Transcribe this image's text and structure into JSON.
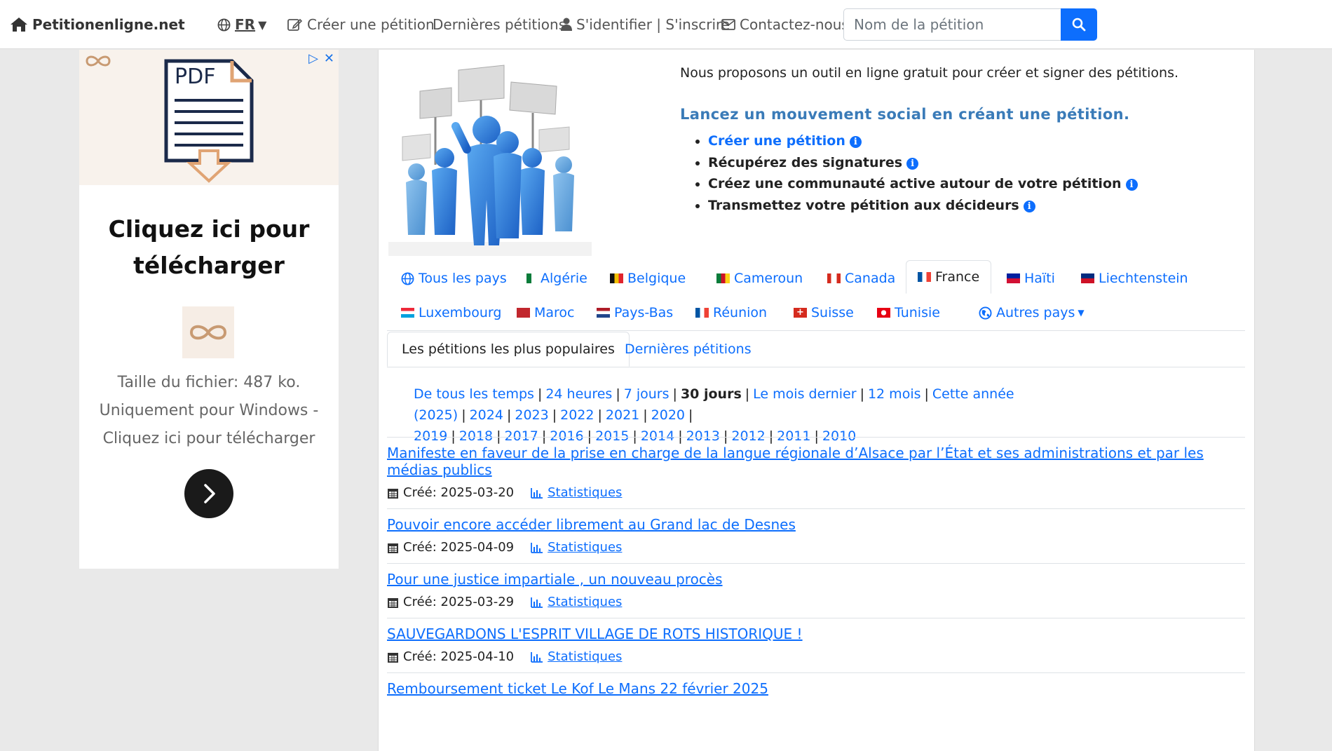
{
  "nav": {
    "brand": "Petitionenligne.net",
    "lang": "FR",
    "create": "Créer une pétition",
    "latest": "Dernières pétitions",
    "login": "S'identifier | S'inscrire",
    "contact": "Contactez-nous",
    "search_placeholder": "Nom de la pétition"
  },
  "ad": {
    "headline_line1": "Cliquez ici pour",
    "headline_line2": "télécharger",
    "pdf_label": "PDF",
    "desc_line1": "Taille du fichier: 487 ko.",
    "desc_line2": "Uniquement pour Windows -",
    "desc_line3": "Cliquez ici pour télécharger"
  },
  "intro": {
    "text": "Nous proposons un outil en ligne gratuit pour créer et signer des pétitions.",
    "slogan": "Lancez un mouvement social en créant une pétition.",
    "bullets": [
      "Créer une pétition",
      "Récupérez des signatures",
      "Créez une communauté active autour de votre pétition",
      "Transmettez votre pétition aux décideurs"
    ]
  },
  "countries": [
    {
      "label": "Tous les pays"
    },
    {
      "label": "Algérie",
      "flag": "#0a7c3a"
    },
    {
      "label": "Belgique",
      "flag": "#f2c000"
    },
    {
      "label": "Cameroun",
      "flag": "#0a7c3a"
    },
    {
      "label": "Canada",
      "flag": "#d52b1e"
    },
    {
      "label": "France",
      "flag": "#0055a4"
    },
    {
      "label": "Haïti",
      "flag": "#00209f"
    },
    {
      "label": "Liechtenstein",
      "flag": "#002b7f"
    },
    {
      "label": "Luxembourg",
      "flag": "#ed2939"
    },
    {
      "label": "Maroc",
      "flag": "#c1272d"
    },
    {
      "label": "Pays-Bas",
      "flag": "#21468b"
    },
    {
      "label": "Réunion",
      "flag": "#0055a4"
    },
    {
      "label": "Suisse",
      "flag": "#d52b1e"
    },
    {
      "label": "Tunisie",
      "flag": "#e70013"
    },
    {
      "label": "Autres pays"
    }
  ],
  "ptabs": [
    "Les pétitions les plus populaires",
    "Dernières pétitions"
  ],
  "periods": {
    "all": "De tous les temps",
    "h24": "24 heures",
    "d7": "7 jours",
    "d30": "30 jours",
    "lastmonth": "Le mois dernier",
    "m12": "12 mois",
    "thisyear": "Cette année (2025)",
    "years": [
      "2024",
      "2023",
      "2022",
      "2021",
      "2020",
      "2019",
      "2018",
      "2017",
      "2016",
      "2015",
      "2014",
      "2013",
      "2012",
      "2011",
      "2010"
    ]
  },
  "petitions": [
    {
      "title": "Manifeste en faveur de la prise en charge de la langue régionale d’Alsace par l’État et ses administrations et par les médias publics",
      "created": "Créé: 2025-03-20",
      "stats": "Statistiques"
    },
    {
      "title": "Pouvoir encore accéder librement au Grand lac de Desnes",
      "created": "Créé: 2025-04-09",
      "stats": "Statistiques"
    },
    {
      "title": "Pour une justice impartiale , un nouveau procès",
      "created": "Créé: 2025-03-29",
      "stats": "Statistiques"
    },
    {
      "title": "SAUVEGARDONS L'ESPRIT VILLAGE DE ROTS HISTORIQUE !",
      "created": "Créé: 2025-04-10",
      "stats": "Statistiques"
    },
    {
      "title": "Remboursement ticket Le Kof Le Mans 22 février 2025",
      "created": "",
      "stats": ""
    }
  ],
  "colors": {
    "accent": "#0d6efd",
    "slogan": "#3a7bb8"
  }
}
